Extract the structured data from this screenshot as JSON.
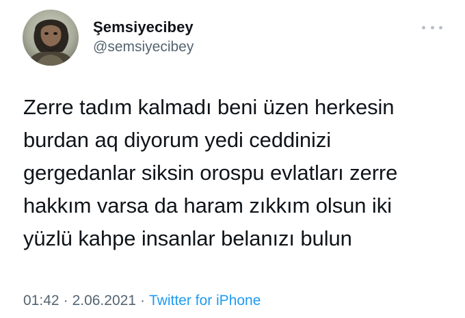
{
  "tweet": {
    "author": {
      "display_name": "Şemsiyecibey",
      "handle": "@semsiyecibey"
    },
    "text": "Zerre tadım kalmadı beni üzen herkesin\nburdan aq diyorum yedi ceddinizi\ngergedanlar siksin orospu evlatları zerre\nhakkım varsa da haram zıkkım olsun iki\nyüzlü kahpe insanlar belanızı bulun",
    "time": "01:42",
    "separator": "·",
    "date": "2.06.2021",
    "source": "Twitter for iPhone",
    "colors": {
      "text": "#0f1419",
      "secondary": "#536471",
      "link": "#1d9bf0"
    },
    "icons": {
      "more": "more-horizontal-icon"
    }
  }
}
